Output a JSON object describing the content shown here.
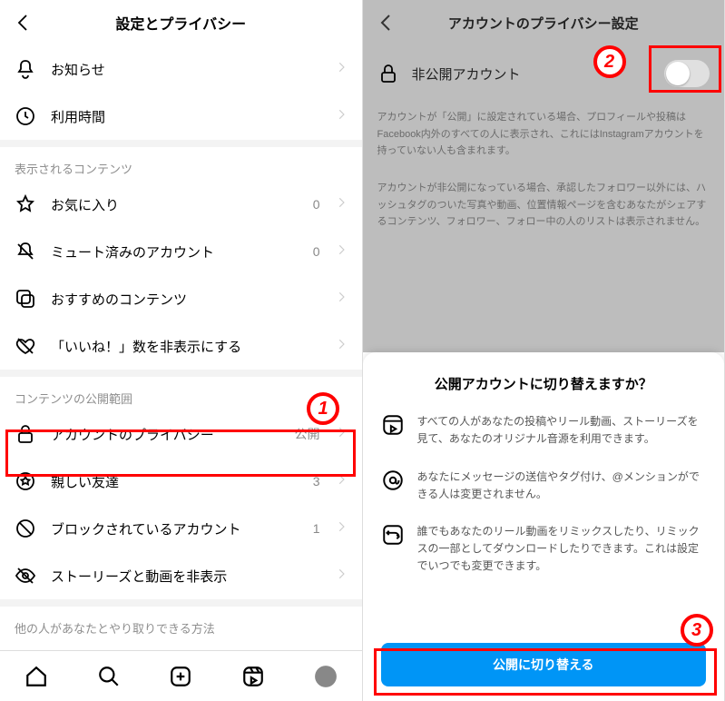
{
  "left": {
    "title": "設定とプライバシー",
    "group1": [
      {
        "icon": "bell",
        "label": "お知らせ"
      },
      {
        "icon": "clock",
        "label": "利用時間"
      }
    ],
    "section_content_label": "表示されるコンテンツ",
    "group2": [
      {
        "icon": "star",
        "label": "お気に入り",
        "val": "0"
      },
      {
        "icon": "bell-mute",
        "label": "ミュート済みのアカウント",
        "val": "0"
      },
      {
        "icon": "suggest",
        "label": "おすすめのコンテンツ"
      },
      {
        "icon": "heart-off",
        "label": "「いいね！」数を非表示にする"
      }
    ],
    "section_privacy_label": "コンテンツの公開範囲",
    "group3": [
      {
        "icon": "lock",
        "label": "アカウントのプライバシー",
        "val": "公開"
      },
      {
        "icon": "star-circle",
        "label": "親しい友達",
        "val": "3"
      },
      {
        "icon": "block",
        "label": "ブロックされているアカウント",
        "val": "1"
      },
      {
        "icon": "eye-off",
        "label": "ストーリーズと動画を非表示"
      }
    ],
    "section_interaction_label": "他の人があなたとやり取りできる方法"
  },
  "right": {
    "title": "アカウントのプライバシー設定",
    "private_account_label": "非公開アカウント",
    "desc1": "アカウントが「公開」に設定されている場合、プロフィールや投稿はFacebook内外のすべての人に表示され、これにはInstagramアカウントを持っていない人も含まれます。",
    "desc2": "アカウントが非公開になっている場合、承認したフォロワー以外には、ハッシュタグのついた写真や動画、位置情報ページを含むあなたがシェアするコンテンツ、フォロワー、フォロー中の人のリストは表示されません。",
    "sheet_title": "公開アカウントに切り替えますか？",
    "sheet_items": [
      "すべての人があなたの投稿やリール動画、ストーリーズを見て、あなたのオリジナル音源を利用できます。",
      "あなたにメッセージの送信やタグ付け、@メンションができる人は変更されません。",
      "誰でもあなたのリール動画をリミックスしたり、リミックスの一部としてダウンロードしたりできます。これは設定でいつでも変更できます。"
    ],
    "cta_label": "公開に切り替える"
  },
  "callouts": {
    "n1": "1",
    "n2": "2",
    "n3": "3"
  }
}
